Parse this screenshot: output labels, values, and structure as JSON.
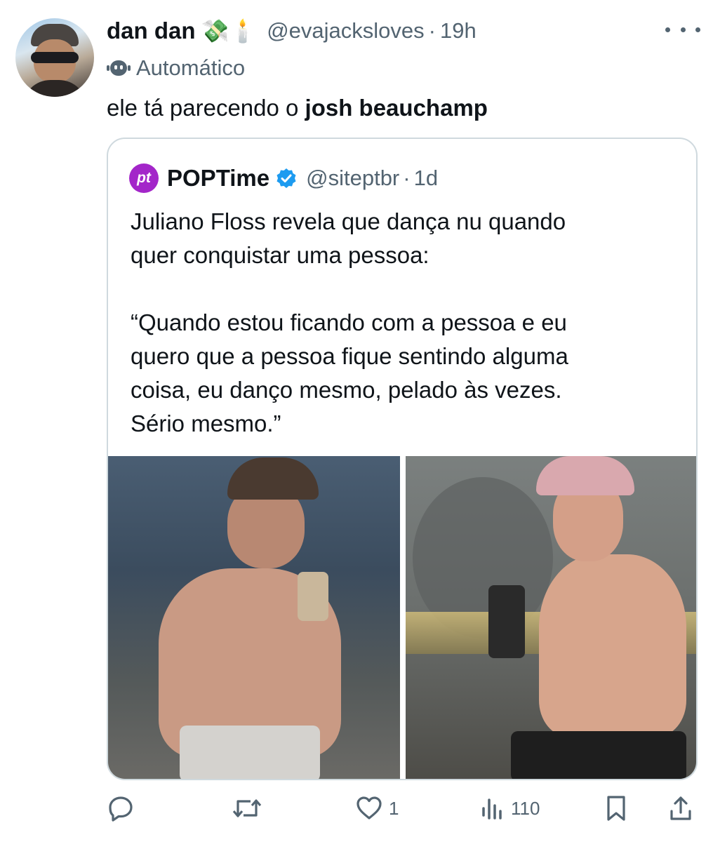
{
  "tweet": {
    "author_name": "dan dan",
    "author_emoji": "💸🕯️",
    "author_handle": "@evajacksloves",
    "separator": "·",
    "time": "19h",
    "automated_label": "Automático",
    "text_plain": "ele tá parecendo o ",
    "text_bold": "josh beauchamp"
  },
  "quote": {
    "logo_text": "pt",
    "name": "POPTime",
    "handle": "@siteptbr",
    "separator": "·",
    "time": "1d",
    "lines": [
      "Juliano Floss revela que dança nu quando",
      "quer conquistar uma pessoa:",
      "“Quando estou ficando com a pessoa e eu",
      "quero que a pessoa fique sentindo alguma",
      "coisa, eu danço mesmo, pelado às vezes.",
      "Sério mesmo.”"
    ],
    "brand_color": "#a326c9",
    "verified_color": "#1d9bf0"
  },
  "actions": {
    "reply": {
      "icon": "reply-icon"
    },
    "retweet": {
      "icon": "retweet-icon"
    },
    "like": {
      "icon": "heart-icon",
      "count": "1"
    },
    "views": {
      "icon": "views-icon",
      "count": "110"
    },
    "bookmark": {
      "icon": "bookmark-icon"
    },
    "share": {
      "icon": "share-icon"
    }
  }
}
